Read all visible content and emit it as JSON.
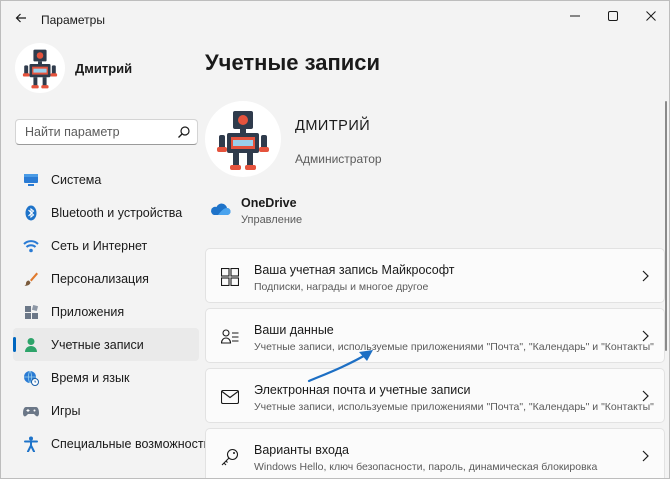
{
  "window": {
    "title": "Параметры"
  },
  "user": {
    "name": "Дмитрий"
  },
  "search": {
    "placeholder": "Найти параметр"
  },
  "nav": [
    {
      "label": "Система",
      "icon": "monitor-icon",
      "active": false
    },
    {
      "label": "Bluetooth и устройства",
      "icon": "bluetooth-icon",
      "active": false
    },
    {
      "label": "Сеть и Интернет",
      "icon": "wifi-icon",
      "active": false
    },
    {
      "label": "Персонализация",
      "icon": "brush-icon",
      "active": false
    },
    {
      "label": "Приложения",
      "icon": "apps-icon",
      "active": false
    },
    {
      "label": "Учетные записи",
      "icon": "person-icon",
      "active": true
    },
    {
      "label": "Время и язык",
      "icon": "globe-clock-icon",
      "active": false
    },
    {
      "label": "Игры",
      "icon": "gamepad-icon",
      "active": false
    },
    {
      "label": "Специальные возможности",
      "icon": "accessibility-icon",
      "active": false
    }
  ],
  "main": {
    "title": "Учетные записи",
    "profile": {
      "name": "ДМИТРИЙ",
      "role": "Администратор"
    },
    "onedrive": {
      "title": "OneDrive",
      "subtitle": "Управление"
    },
    "cards": [
      {
        "title": "Ваша учетная запись Майкрософт",
        "subtitle": "Подписки, награды и многое другое",
        "icon": "windows-logo-icon"
      },
      {
        "title": "Ваши данные",
        "subtitle": "Учетные записи, используемые приложениями \"Почта\", \"Календарь\" и \"Контакты\"",
        "icon": "user-info-icon"
      },
      {
        "title": "Электронная почта и учетные записи",
        "subtitle": "Учетные записи, используемые приложениями \"Почта\", \"Календарь\" и \"Контакты\"",
        "icon": "mail-icon"
      },
      {
        "title": "Варианты входа",
        "subtitle": "Windows Hello, ключ безопасности, пароль, динамическая блокировка",
        "icon": "key-icon"
      }
    ]
  },
  "colors": {
    "accent": "#0067c0",
    "background": "#f3f3f3",
    "card": "#fbfbfb",
    "annotation_arrow": "#1d6fc4"
  }
}
